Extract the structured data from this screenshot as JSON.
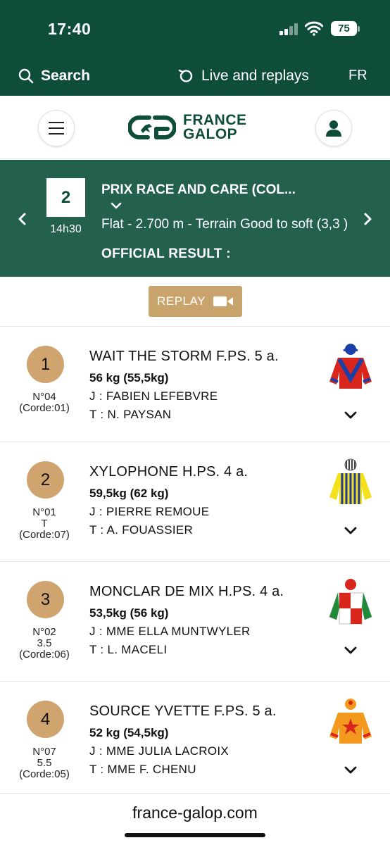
{
  "status_bar": {
    "time": "17:40",
    "battery": "75"
  },
  "top_nav": {
    "search_label": "Search",
    "live_label": "Live and replays",
    "lang": "FR"
  },
  "logo": {
    "line1": "FRANCE",
    "line2": "GALOP"
  },
  "race": {
    "number": "2",
    "time": "14h30",
    "title": "PRIX RACE AND CARE (COL...",
    "details": "Flat - 2.700 m - Terrain Good to soft (3,3 )",
    "official": "OFFICIAL RESULT :"
  },
  "replay": {
    "label": "REPLAY"
  },
  "runners": [
    {
      "position": "1",
      "name": "WAIT THE STORM F.PS. 5 a.",
      "weight": "56 kg (55,5kg)",
      "jockey": "J : FABIEN LEFEBVRE",
      "trainer": "T : N. PAYSAN",
      "meta": [
        "N°04",
        "(Corde:01)"
      ],
      "silks": "red-blue-chevron-silks-icon"
    },
    {
      "position": "2",
      "name": "XYLOPHONE H.PS. 4 a.",
      "weight": "59,5kg (62 kg)",
      "jockey": "J : PIERRE REMOUE",
      "trainer": "T : A. FOUASSIER",
      "meta": [
        "N°01",
        "T",
        "(Corde:07)"
      ],
      "silks": "yellow-blue-stripes-silks-icon"
    },
    {
      "position": "3",
      "name": "MONCLAR DE MIX H.PS. 4 a.",
      "weight": "53,5kg (56 kg)",
      "jockey": "J : MME ELLA MUNTWYLER",
      "trainer": "T : L. MACELI",
      "meta": [
        "N°02",
        "3.5",
        "(Corde:06)"
      ],
      "silks": "red-white-green-silks-icon"
    },
    {
      "position": "4",
      "name": "SOURCE YVETTE F.PS. 5 a.",
      "weight": "52 kg (54,5kg)",
      "jockey": "J : MME JULIA LACROIX",
      "trainer": "T : MME F. CHENU",
      "meta": [
        "N°07",
        "5.5",
        "(Corde:05)"
      ],
      "silks": "orange-red-star-silks-icon"
    }
  ],
  "url_bar": {
    "domain": "france-galop.com"
  },
  "colors": {
    "brand_green": "#0f4d3b",
    "header_green": "#24604e",
    "gold": "#cfa46f",
    "replay_gold": "#c9a36c"
  }
}
